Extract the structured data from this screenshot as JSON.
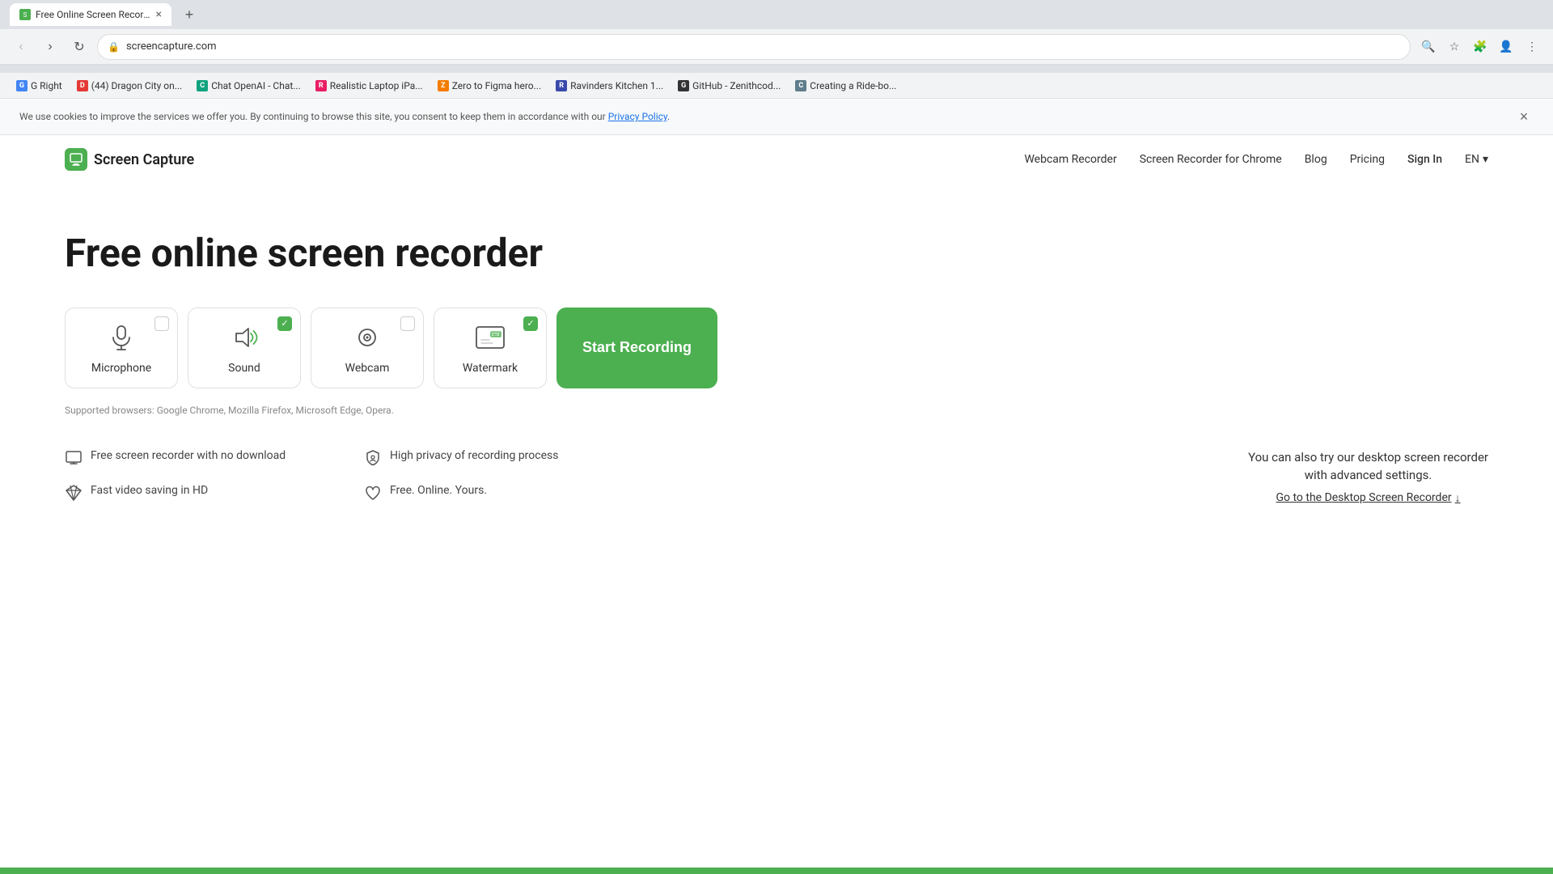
{
  "browser": {
    "tab_title": "Free Online Screen Recorder | C...",
    "tab_favicon": "🎯",
    "url": "screencapture.com",
    "new_tab_label": "+",
    "back_btn": "‹",
    "forward_btn": "›",
    "reload_btn": "↻"
  },
  "bookmarks": [
    {
      "id": "g-right",
      "label": "G Right",
      "color": "#4285f4",
      "text": "G"
    },
    {
      "id": "dragon-city",
      "label": "(44) Dragon City on...",
      "color": "#e53935",
      "text": "D"
    },
    {
      "id": "chat-openai",
      "label": "Chat OpenAI - Chat...",
      "color": "#10a37f",
      "text": "C"
    },
    {
      "id": "realistic-laptop",
      "label": "Realistic Laptop iPa...",
      "color": "#e91e63",
      "text": "R"
    },
    {
      "id": "zero-figma",
      "label": "Zero to Figma hero...",
      "color": "#f57c00",
      "text": "Z"
    },
    {
      "id": "ravinders-kitchen",
      "label": "Ravinders Kitchen 1...",
      "color": "#3949ab",
      "text": "R"
    },
    {
      "id": "github-zenithcod",
      "label": "GitHub - Zenithcod...",
      "color": "#333",
      "text": "G"
    },
    {
      "id": "creating-ride",
      "label": "Creating a Ride-bo...",
      "color": "#607d8b",
      "text": "C"
    }
  ],
  "cookie_banner": {
    "text": "We use cookies to improve the services we offer you. By continuing to browse this site, you consent to keep them in accordance with our",
    "link_text": "Privacy Policy",
    "close_label": "×"
  },
  "nav": {
    "logo_text": "Screen Capture",
    "links": [
      {
        "id": "webcam-recorder",
        "label": "Webcam Recorder"
      },
      {
        "id": "screen-recorder-chrome",
        "label": "Screen Recorder for Chrome"
      },
      {
        "id": "blog",
        "label": "Blog"
      },
      {
        "id": "pricing",
        "label": "Pricing"
      },
      {
        "id": "sign-in",
        "label": "Sign In"
      }
    ],
    "language": "EN"
  },
  "hero": {
    "title": "Free online screen recorder",
    "options": [
      {
        "id": "microphone",
        "label": "Microphone",
        "checked": false
      },
      {
        "id": "sound",
        "label": "Sound",
        "checked": true
      },
      {
        "id": "webcam",
        "label": "Webcam",
        "checked": false
      },
      {
        "id": "watermark",
        "label": "Watermark",
        "checked": true,
        "badge": "FREE"
      }
    ],
    "start_btn_label": "Start Recording",
    "supported_browsers": "Supported browsers: Google Chrome, Mozilla Firefox, Microsoft Edge, Opera."
  },
  "features": [
    {
      "id": "no-download",
      "icon": "monitor",
      "text": "Free screen recorder with no download"
    },
    {
      "id": "high-privacy",
      "icon": "shield",
      "text": "High privacy of recording process"
    },
    {
      "id": "hd-saving",
      "icon": "diamond",
      "text": "Fast video saving in HD"
    },
    {
      "id": "free-online",
      "icon": "heart",
      "text": "Free. Online. Yours."
    }
  ],
  "desktop_cta": {
    "text": "You can also try our desktop screen recorder\nwith advanced settings.",
    "link_text": "Go to the Desktop Screen Recorder",
    "arrow": "↓"
  }
}
